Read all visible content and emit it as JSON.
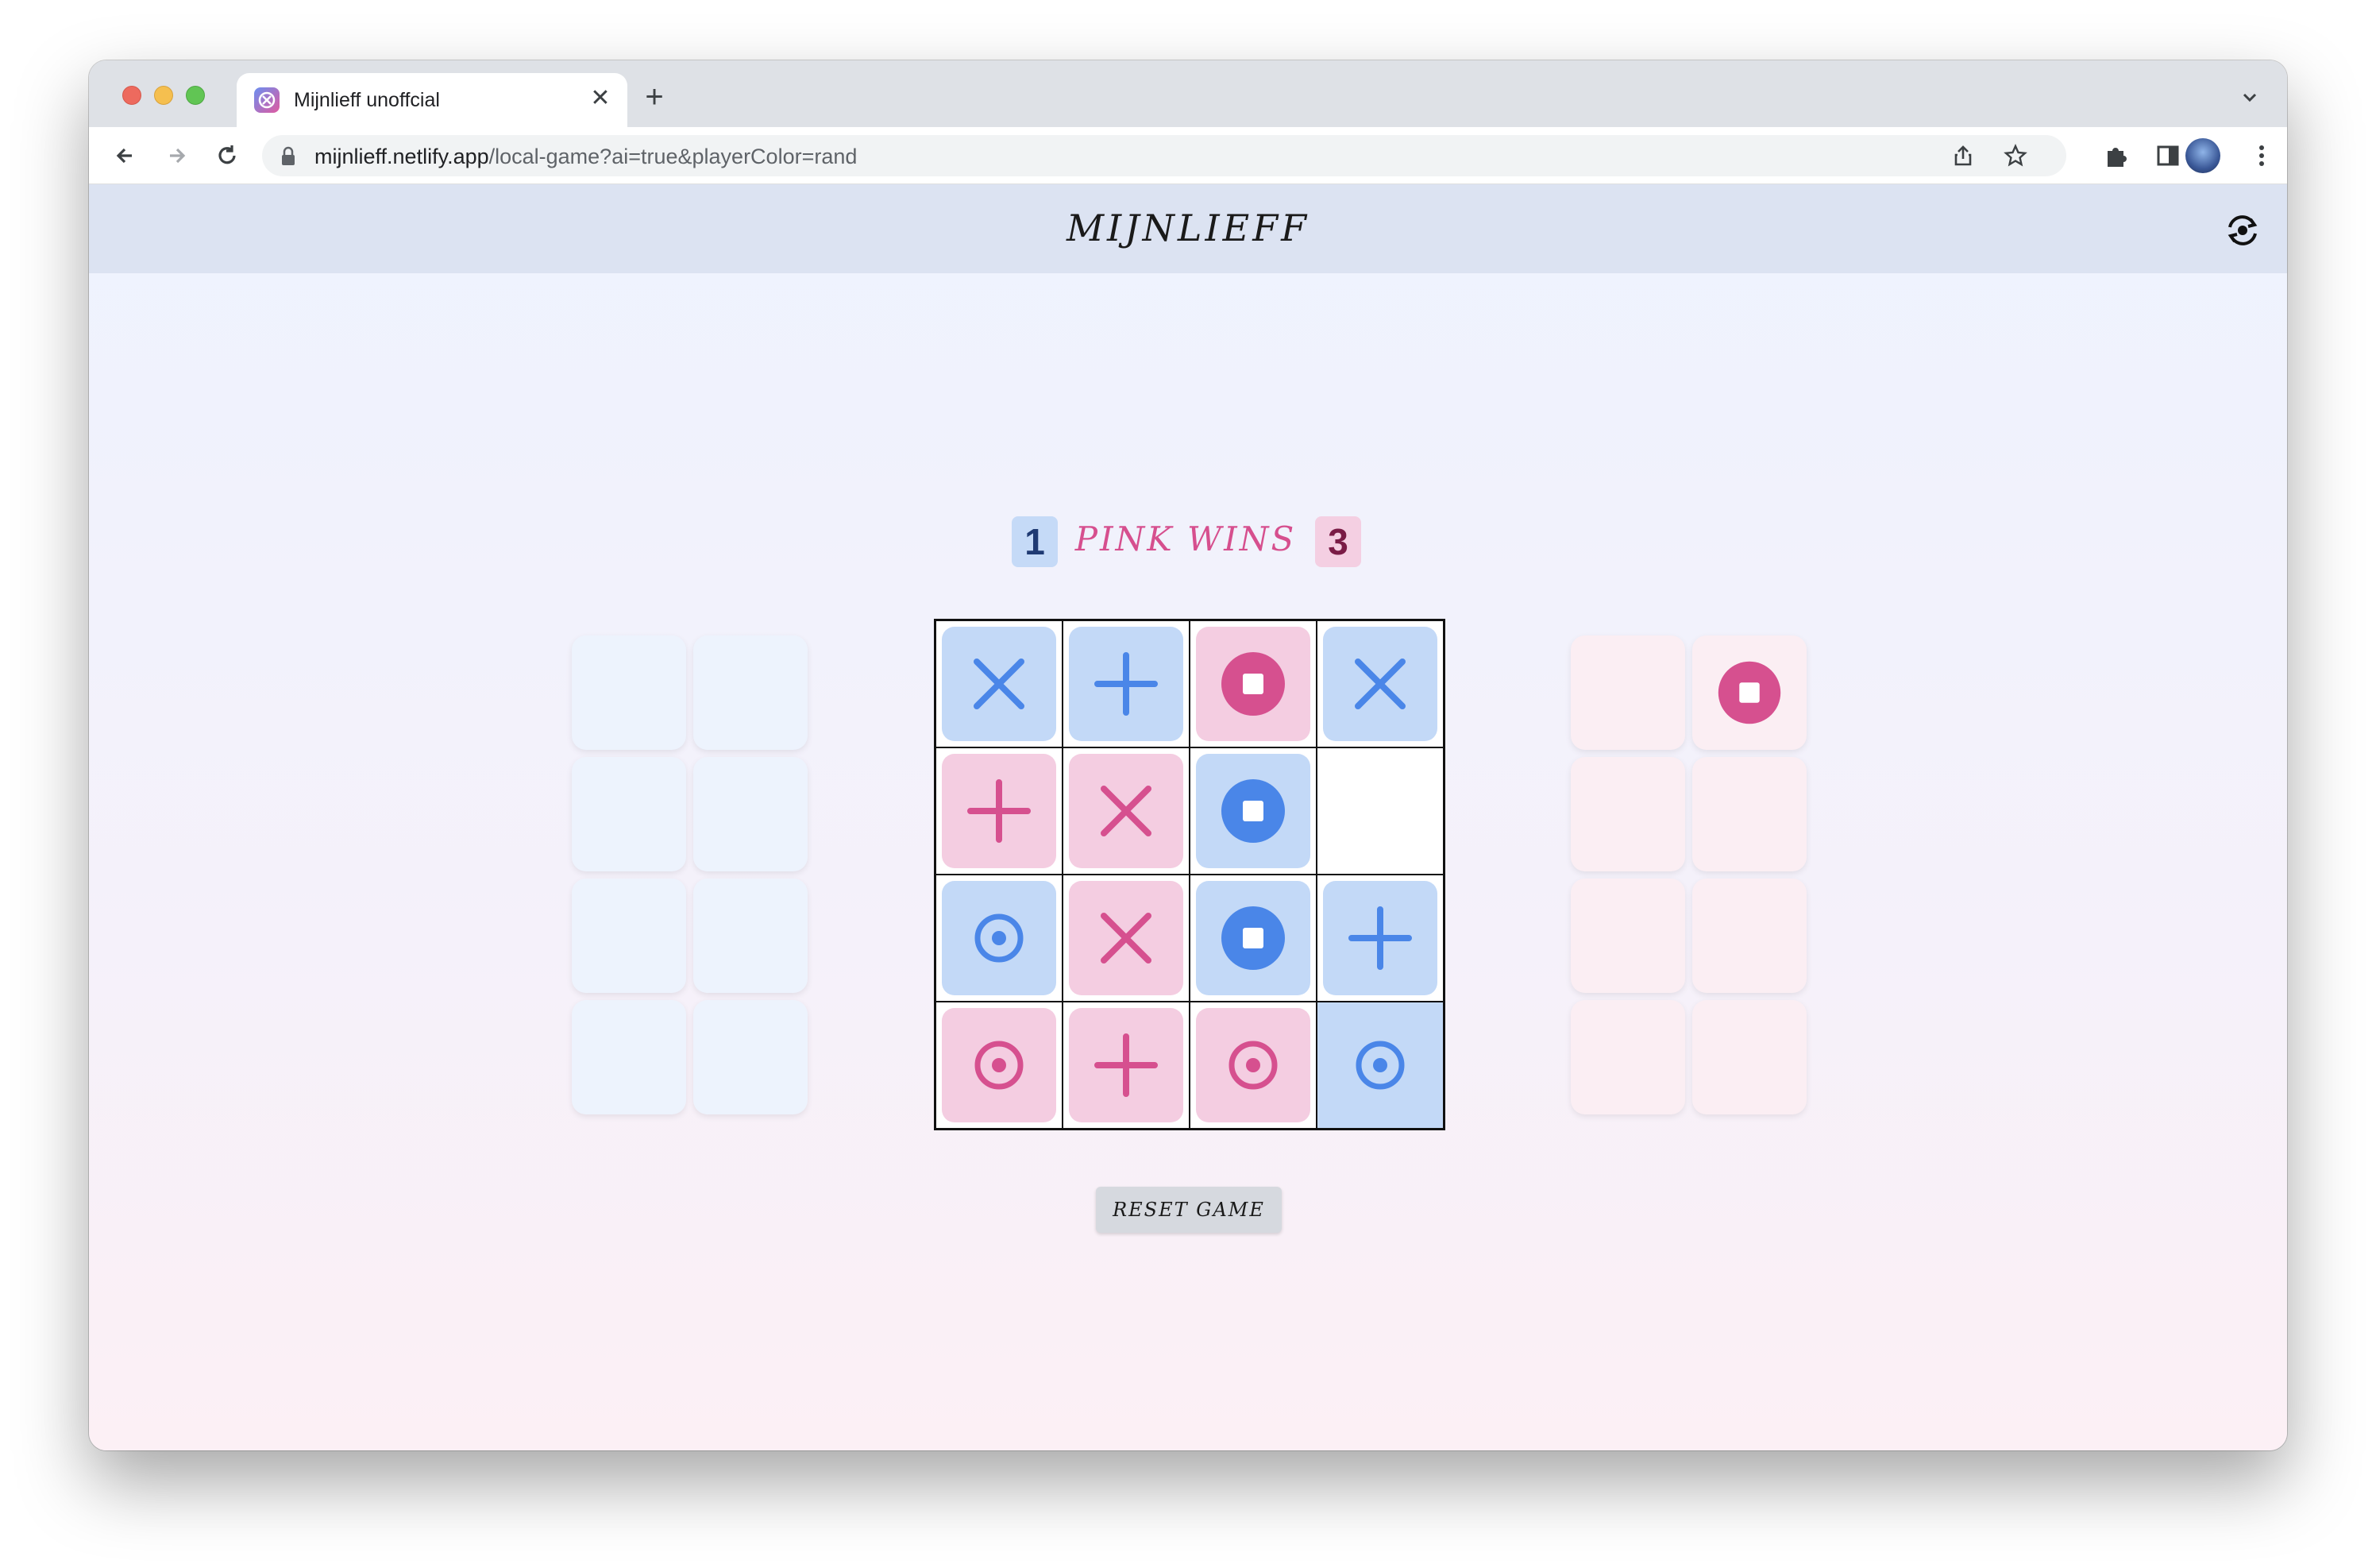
{
  "browser": {
    "tab_title": "Mijnlieff unoffcial",
    "url_host": "mijnlieff.netlify.app",
    "url_path": "/local-game?ai=true&playerColor=rand"
  },
  "app": {
    "title": "MIJNLIEFF",
    "score_blue": "1",
    "score_pink": "3",
    "status": "PINK WINS",
    "reset_label": "RESET GAME"
  },
  "colors": {
    "blue_piece": "#4a86e8",
    "pink_piece": "#d6508f",
    "blue_tile": "#c3d9f7",
    "pink_tile": "#f4cde1"
  },
  "board": [
    [
      {
        "color": "blue",
        "shape": "cross"
      },
      {
        "color": "blue",
        "shape": "plus"
      },
      {
        "color": "pink",
        "shape": "square"
      },
      {
        "color": "blue",
        "shape": "cross"
      }
    ],
    [
      {
        "color": "pink",
        "shape": "plus"
      },
      {
        "color": "pink",
        "shape": "cross"
      },
      {
        "color": "blue",
        "shape": "square"
      },
      null
    ],
    [
      {
        "color": "blue",
        "shape": "target"
      },
      {
        "color": "pink",
        "shape": "cross"
      },
      {
        "color": "blue",
        "shape": "square"
      },
      {
        "color": "blue",
        "shape": "plus"
      }
    ],
    [
      {
        "color": "pink",
        "shape": "target"
      },
      {
        "color": "pink",
        "shape": "plus"
      },
      {
        "color": "pink",
        "shape": "target"
      },
      {
        "color": "blue",
        "shape": "target",
        "highlight": true
      }
    ]
  ],
  "blue_reserve": [
    null,
    null,
    null,
    null,
    null,
    null,
    null,
    null
  ],
  "pink_reserve": [
    null,
    {
      "color": "pink",
      "shape": "square"
    },
    null,
    null,
    null,
    null,
    null,
    null
  ]
}
